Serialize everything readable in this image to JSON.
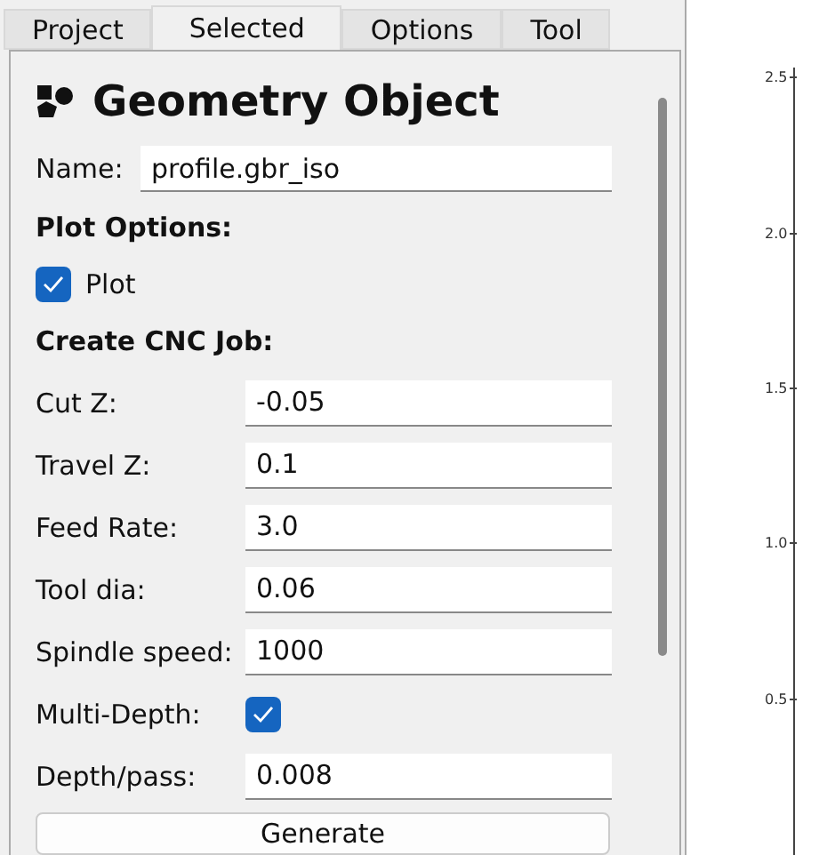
{
  "tabs": [
    {
      "label": "Project",
      "selected": false
    },
    {
      "label": "Selected",
      "selected": true
    },
    {
      "label": "Options",
      "selected": false
    },
    {
      "label": "Tool",
      "selected": false
    }
  ],
  "panel": {
    "title": "Geometry Object",
    "name_label": "Name:",
    "name_value": "profile.gbr_iso",
    "plot_section": "Plot Options:",
    "plot_checkbox": {
      "label": "Plot",
      "checked": true
    },
    "cnc_section": "Create CNC Job:",
    "fields": [
      {
        "kind": "input",
        "label": "Cut Z:",
        "value": "-0.05"
      },
      {
        "kind": "input",
        "label": "Travel Z:",
        "value": "0.1"
      },
      {
        "kind": "input",
        "label": "Feed Rate:",
        "value": "3.0"
      },
      {
        "kind": "input",
        "label": "Tool dia:",
        "value": "0.06"
      },
      {
        "kind": "input",
        "label": "Spindle speed:",
        "value": "1000"
      },
      {
        "kind": "checkbox",
        "label": "Multi-Depth:",
        "checked": true
      },
      {
        "kind": "input",
        "label": "Depth/pass:",
        "value": "0.008"
      }
    ],
    "button": "Generate"
  },
  "plot": {
    "y_ticks": [
      "2.5",
      "2.0",
      "1.5",
      "1.0",
      "0.5"
    ]
  }
}
